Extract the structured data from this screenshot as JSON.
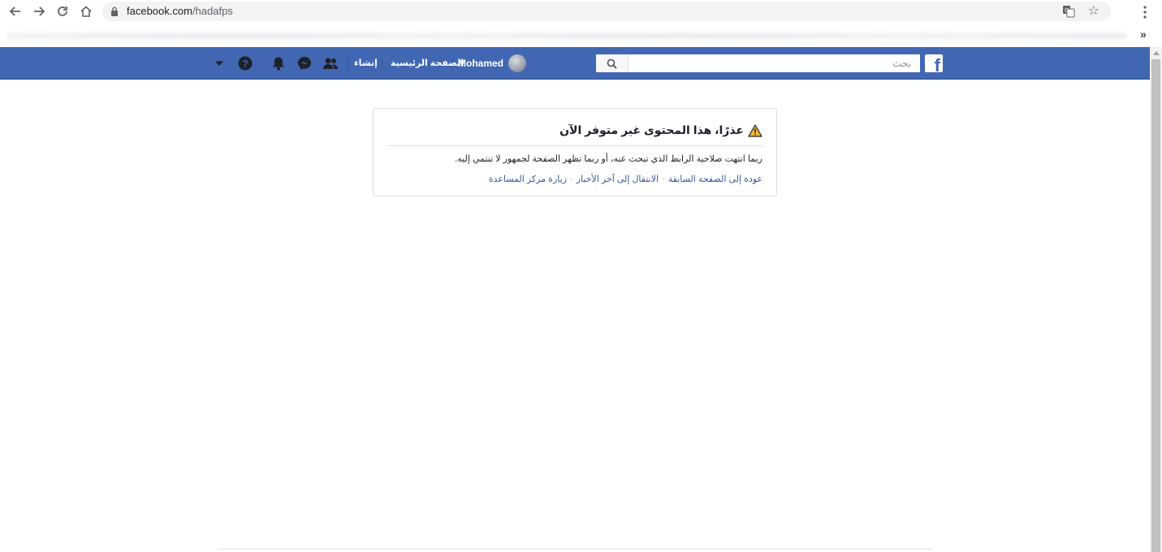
{
  "browser": {
    "url_domain": "facebook.com",
    "url_path": "/hadafps",
    "bookmarks_more": "»"
  },
  "header": {
    "logo": "f",
    "search_placeholder": "بحث",
    "profile_name": "Mohamed",
    "home_label": "الصفحة الرئيسية",
    "create_label": "إنشاء",
    "brand_color": "#4267b2",
    "icons": [
      "friends-icon",
      "messenger-icon",
      "notifications-icon",
      "help-icon",
      "account-dropdown-icon"
    ]
  },
  "error": {
    "title": "عذرًا، هذا المحتوى غير متوفر الآن",
    "body": "ربما انتهت صلاحية الرابط الذي تبحث عنه، أو ربما تظهر الصفحة لجمهور لا تنتمي إليه.",
    "links": {
      "back": "عودة إلى الصفحة السابقة",
      "news": "الانتقال إلى آخر الأخبار",
      "help": "زيارة مركز المساعدة",
      "separator": "·"
    }
  }
}
